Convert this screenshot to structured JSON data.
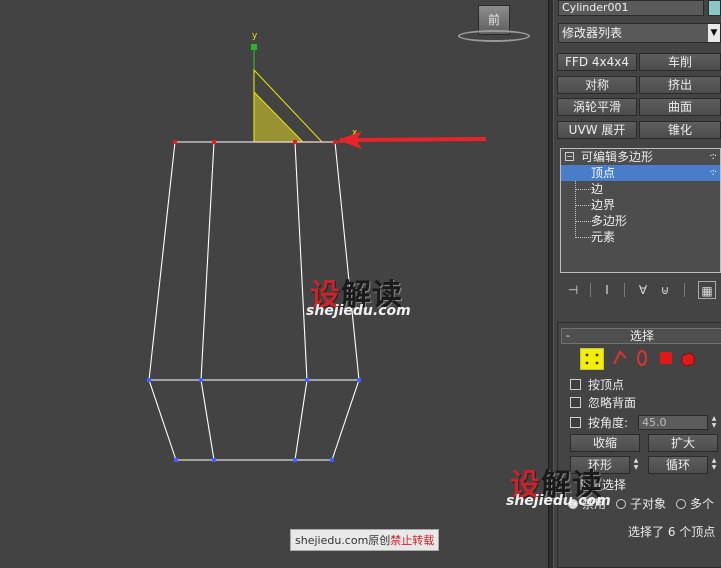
{
  "viewport": {
    "view_cube_label": "前",
    "axis_y_label": "y",
    "axis_x_label": "x"
  },
  "watermark": {
    "main_red": "设",
    "main_dark": "解读",
    "url": "shejiedu.com",
    "footer_prefix": "shejiedu.com原创",
    "footer_warning": "禁止转载"
  },
  "panel": {
    "object_name": "Cylinder001",
    "object_color": "#8cc6c6",
    "modifier_list": "修改器列表",
    "modifier_buttons": [
      "FFD 4x4x4",
      "车削",
      "对称",
      "挤出",
      "涡轮平滑",
      "曲面",
      "UVW 展开",
      "锥化"
    ],
    "stack": {
      "root": "可编辑多边形",
      "levels": [
        "顶点",
        "边",
        "边界",
        "多边形",
        "元素"
      ],
      "selected_level": "顶点"
    },
    "selection_rollout": {
      "title": "选择",
      "by_vertex": "按顶点",
      "ignore_backfacing": "忽略背面",
      "by_angle": "按角度:",
      "angle_value": "45.0",
      "shrink": "收缩",
      "grow": "扩大",
      "ring": "环形",
      "loop": "循环",
      "preview_group": "预览选择",
      "preview_off": "禁用",
      "preview_subobject": "子对象",
      "preview_multi": "多个",
      "status": "选择了 6 个顶点"
    },
    "accent_color": "#4a7dc9"
  }
}
